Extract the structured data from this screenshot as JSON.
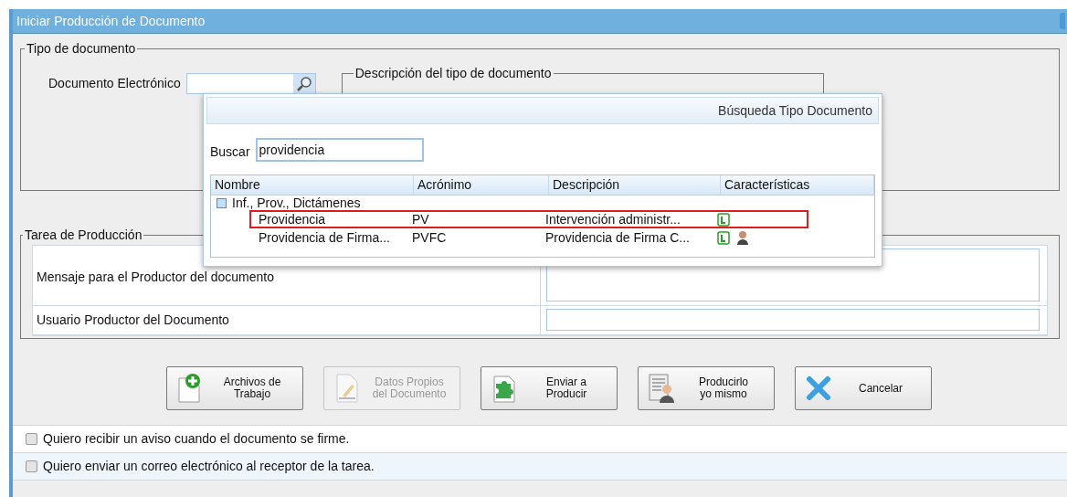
{
  "window": {
    "title": "Iniciar Producción de Documento"
  },
  "tipo_documento": {
    "legend": "Tipo de documento",
    "field_label": "Documento Electrónico",
    "description_legend": "Descripción del tipo de documento"
  },
  "popup": {
    "title": "Búsqueda Tipo Documento",
    "search_label": "Buscar",
    "search_value": "providencia",
    "columns": [
      "Nombre",
      "Acrónimo",
      "Descripción",
      "Características"
    ],
    "group": {
      "label": "Inf., Prov., Dictámenes",
      "expanded": true
    },
    "rows": [
      {
        "nombre": "Providencia",
        "acronimo": "PV",
        "descripcion": "Intervención administr...",
        "signer_icon": false,
        "selected": true
      },
      {
        "nombre": "Providencia de Firma...",
        "acronimo": "PVFC",
        "descripcion": "Providencia de Firma C...",
        "signer_icon": true,
        "selected": false
      }
    ]
  },
  "tarea": {
    "legend": "Tarea de Producción",
    "fields": [
      "Mensaje para el Productor del documento",
      "Usuario Productor del Documento"
    ]
  },
  "buttons": [
    {
      "kind": "files",
      "label": "Archivos de\nTrabajo",
      "disabled": false
    },
    {
      "kind": "data",
      "label": "Datos Propios\ndel Documento",
      "disabled": true
    },
    {
      "kind": "send",
      "label": "Enviar a\nProducir",
      "disabled": false
    },
    {
      "kind": "self",
      "label": "Producirlo\nyo mismo",
      "disabled": false
    },
    {
      "kind": "cancel",
      "label": "Cancelar",
      "disabled": false
    }
  ],
  "options": [
    {
      "label": "Quiero recibir un aviso cuando el documento se firme.",
      "checked": false
    },
    {
      "label": "Quiero enviar un correo electrónico al receptor de la tarea.",
      "checked": false
    }
  ]
}
